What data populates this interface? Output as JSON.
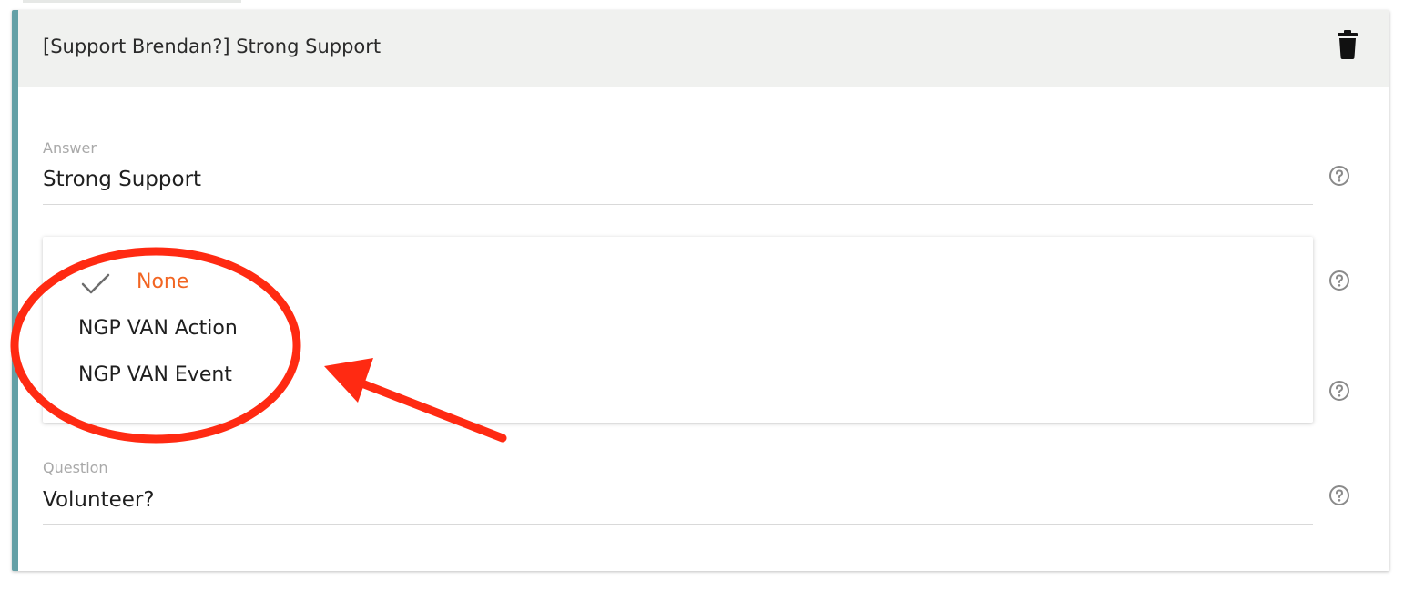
{
  "card": {
    "title": "[Support Brendan?] Strong Support",
    "delete_icon": "trash-icon"
  },
  "answer_field": {
    "label": "Answer",
    "value": "Strong Support",
    "help_icon": "help-circle-icon"
  },
  "action_dropdown": {
    "options": [
      {
        "label": "None",
        "selected": true
      },
      {
        "label": "NGP VAN Action",
        "selected": false
      },
      {
        "label": "NGP VAN Event",
        "selected": false
      }
    ],
    "selected_color": "#f26522",
    "check_icon": "check-icon"
  },
  "question_field": {
    "label": "Question",
    "value": "Volunteer?",
    "help_icon": "help-circle-icon"
  },
  "colors": {
    "accent_bar": "#64a0a6",
    "header_bg": "#f0f1ef",
    "annotation_red": "#ff2a12"
  },
  "annotation": {
    "shapes": [
      "red-ellipse",
      "red-arrow"
    ]
  }
}
